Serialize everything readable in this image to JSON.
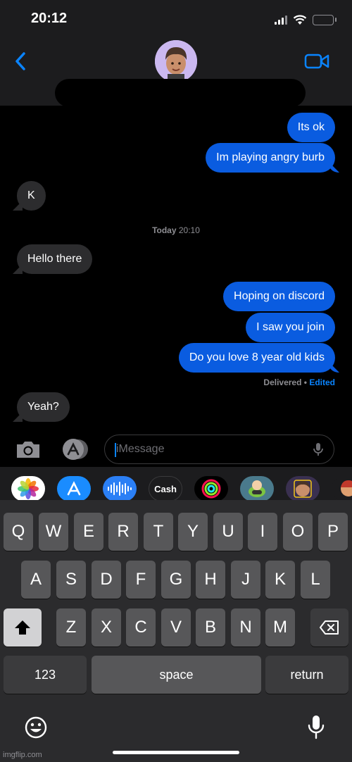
{
  "status_bar": {
    "time": "20:12"
  },
  "header": {
    "back_icon": "chevron-left-icon",
    "video_icon": "video-camera-icon",
    "avatar_icon": "memoji-avatar",
    "accent": "#0a84ff"
  },
  "messages": [
    {
      "text": "Its ok",
      "from": "me"
    },
    {
      "text": "Im playing angry burb",
      "from": "me"
    },
    {
      "text": "K",
      "from": "them"
    },
    {
      "text": "Hello there",
      "from": "them"
    },
    {
      "text": "Hoping on discord",
      "from": "me"
    },
    {
      "text": "I saw you join",
      "from": "me"
    },
    {
      "text": "Do you love 8 year old kids",
      "from": "me"
    },
    {
      "text": "Yeah?",
      "from": "them"
    }
  ],
  "timestamp": {
    "day": "Today",
    "time": "20:10"
  },
  "delivery": {
    "status": "Delivered",
    "separator": "•",
    "edited": "Edited"
  },
  "compose": {
    "placeholder": "iMessage"
  },
  "app_strip": [
    "photos-icon",
    "app-store-icon",
    "audio-message-icon",
    "apple-cash-icon",
    "activity-icon",
    "game-icon",
    "memoji-icon",
    "memoji-stickers-icon"
  ],
  "apple_cash_label": "Cash",
  "keyboard": {
    "row1": [
      "Q",
      "W",
      "E",
      "R",
      "T",
      "Y",
      "U",
      "I",
      "O",
      "P"
    ],
    "row2": [
      "A",
      "S",
      "D",
      "F",
      "G",
      "H",
      "J",
      "K",
      "L"
    ],
    "row3": [
      "Z",
      "X",
      "C",
      "V",
      "B",
      "N",
      "M"
    ],
    "numbers": "123",
    "space": "space",
    "return": "return"
  },
  "watermark": "imgflip.com",
  "colors": {
    "outgoing": "#0a5ce0",
    "incoming": "#2c2c2e",
    "background": "#000000"
  }
}
